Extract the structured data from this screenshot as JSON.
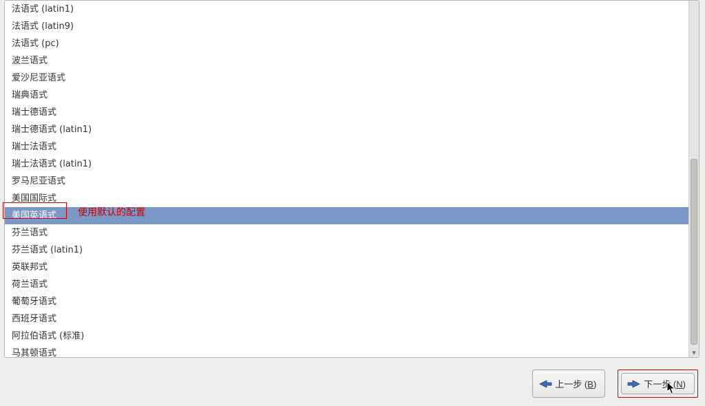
{
  "list": {
    "items": [
      "法语式 (latin1)",
      "法语式 (latin9)",
      "法语式 (pc)",
      "波兰语式",
      "爱沙尼亚语式",
      "瑞典语式",
      "瑞士德语式",
      "瑞士德语式 (latin1)",
      "瑞士法语式",
      "瑞士法语式 (latin1)",
      "罗马尼亚语式",
      "美国国际式",
      "美国英语式",
      "芬兰语式",
      "芬兰语式 (latin1)",
      "英联邦式",
      "荷兰语式",
      "葡萄牙语式",
      "西班牙语式",
      "阿拉伯语式 (标准)",
      "马其顿语式"
    ],
    "selected_index": 12
  },
  "annotation": {
    "text": "使用默认的配置"
  },
  "buttons": {
    "back_label_before": "上一步 (",
    "back_mnemonic": "B",
    "back_label_after": ")",
    "next_label_before": "下一",
    "next_label_mid": " (",
    "next_mnemonic": "N",
    "next_label_after": ")"
  }
}
